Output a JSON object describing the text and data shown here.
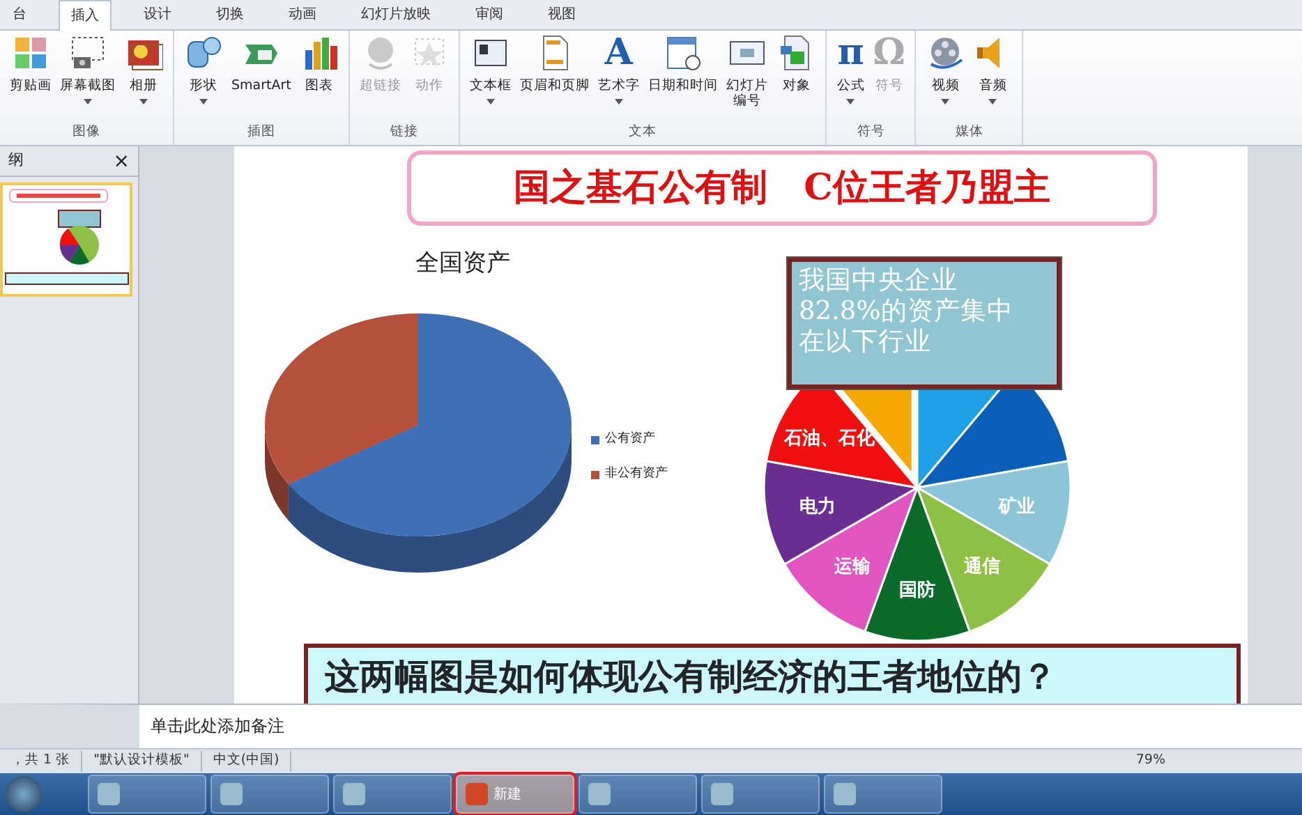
{
  "ribbon_tabs": [
    {
      "label": "台",
      "selected": false
    },
    {
      "label": "插入",
      "selected": true
    },
    {
      "label": "设计",
      "selected": false
    },
    {
      "label": "切换",
      "selected": false
    },
    {
      "label": "动画",
      "selected": false
    },
    {
      "label": "幻灯片放映",
      "selected": false
    },
    {
      "label": "审阅",
      "selected": false
    },
    {
      "label": "视图",
      "selected": false
    }
  ],
  "ribbon_groups": [
    {
      "label": "图像",
      "buttons": [
        {
          "label": "剪贴画",
          "disabled": false,
          "dropdown": false
        },
        {
          "label": "屏幕截图",
          "disabled": false,
          "dropdown": true
        },
        {
          "label": "相册",
          "disabled": false,
          "dropdown": true
        }
      ]
    },
    {
      "label": "插图",
      "buttons": [
        {
          "label": "形状",
          "disabled": false,
          "dropdown": true
        },
        {
          "label": "SmartArt",
          "disabled": false,
          "dropdown": false
        },
        {
          "label": "图表",
          "disabled": false,
          "dropdown": false
        }
      ]
    },
    {
      "label": "链接",
      "buttons": [
        {
          "label": "超链接",
          "disabled": true,
          "dropdown": false
        },
        {
          "label": "动作",
          "disabled": true,
          "dropdown": false
        }
      ]
    },
    {
      "label": "文本",
      "buttons": [
        {
          "label": "文本框",
          "disabled": false,
          "dropdown": true
        },
        {
          "label": "页眉和页脚",
          "disabled": false,
          "dropdown": false
        },
        {
          "label": "艺术字",
          "disabled": false,
          "dropdown": true,
          "glyph": "A"
        },
        {
          "label": "日期和时间",
          "disabled": false,
          "dropdown": false
        },
        {
          "label": "幻灯片编号",
          "disabled": false,
          "dropdown": false,
          "wrap": true
        },
        {
          "label": "对象",
          "disabled": false,
          "dropdown": false
        }
      ]
    },
    {
      "label": "符号",
      "buttons": [
        {
          "label": "公式",
          "disabled": false,
          "dropdown": true,
          "glyph": "π"
        },
        {
          "label": "符号",
          "disabled": true,
          "dropdown": false,
          "glyph": "Ω"
        }
      ]
    },
    {
      "label": "媒体",
      "buttons": [
        {
          "label": "视频",
          "disabled": false,
          "dropdown": true
        },
        {
          "label": "音频",
          "disabled": false,
          "dropdown": true
        }
      ]
    }
  ],
  "side_panel": {
    "tab": "纲",
    "close": "×"
  },
  "slide": {
    "title": "国之基石公有制　C位王者乃盟主",
    "left_chart": {
      "title": "全国资产",
      "legend": [
        {
          "label": "公有资产",
          "color": "#3f6fb5"
        },
        {
          "label": "非公有资产",
          "color": "#b5503c"
        }
      ]
    },
    "callout": [
      "我国中央企业",
      "82.8%的资产集中",
      "在以下行业"
    ],
    "right_chart": {
      "slices": [
        {
          "color": "#1ea0e6"
        },
        {
          "color": "#0b5fb8"
        },
        {
          "label": "矿业",
          "color": "#8cc4d8"
        },
        {
          "label": "通信",
          "color": "#8dc044"
        },
        {
          "label": "国防",
          "color": "#0a6b2a"
        },
        {
          "label": "运输",
          "color": "#e055c0"
        },
        {
          "label": "电力",
          "color": "#6a2d91"
        },
        {
          "label": "石油、石化",
          "color": "#f01010"
        },
        {
          "color": "#f5a800"
        }
      ]
    },
    "question": "这两幅图是如何体现公有制经济的王者地位的？"
  },
  "notes": {
    "placeholder": "单击此处添加备注"
  },
  "status_bar": {
    "items": [
      "，共 1 张",
      "\"默认设计模板\"",
      "中文(中国)"
    ],
    "zoom": "79%"
  },
  "taskbar": {
    "items": [
      {
        "selected": false,
        "annotated": false
      },
      {
        "selected": false,
        "annotated": false
      },
      {
        "selected": false,
        "annotated": false
      },
      {
        "label": "新建",
        "selected": true,
        "annotated": true
      },
      {
        "selected": false,
        "annotated": false
      },
      {
        "selected": false,
        "annotated": false
      },
      {
        "selected": false,
        "annotated": false
      }
    ]
  }
}
